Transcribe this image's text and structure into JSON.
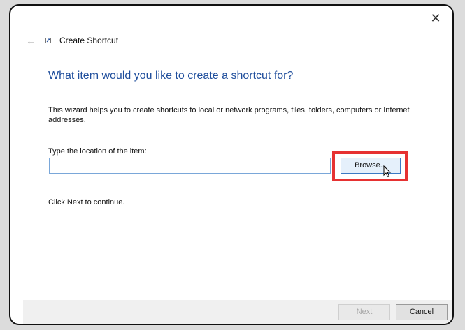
{
  "window": {
    "title": "Create Shortcut",
    "close_glyph": "✕",
    "back_glyph": "←"
  },
  "main": {
    "heading": "What item would you like to create a shortcut for?",
    "description": "This wizard helps you to create shortcuts to local or network programs, files, folders, computers or Internet addresses.",
    "location_label": "Type the location of the item:",
    "location_value": "",
    "browse_label": "Browse...",
    "hint": "Click Next to continue."
  },
  "footer": {
    "next_label": "Next",
    "cancel_label": "Cancel"
  },
  "colors": {
    "heading": "#1f4e9c",
    "highlight": "#e63232",
    "input_border": "#7aa7d9"
  },
  "icons": [
    "close-icon",
    "back-arrow-icon",
    "shortcut-app-icon",
    "mouse-cursor-icon"
  ]
}
